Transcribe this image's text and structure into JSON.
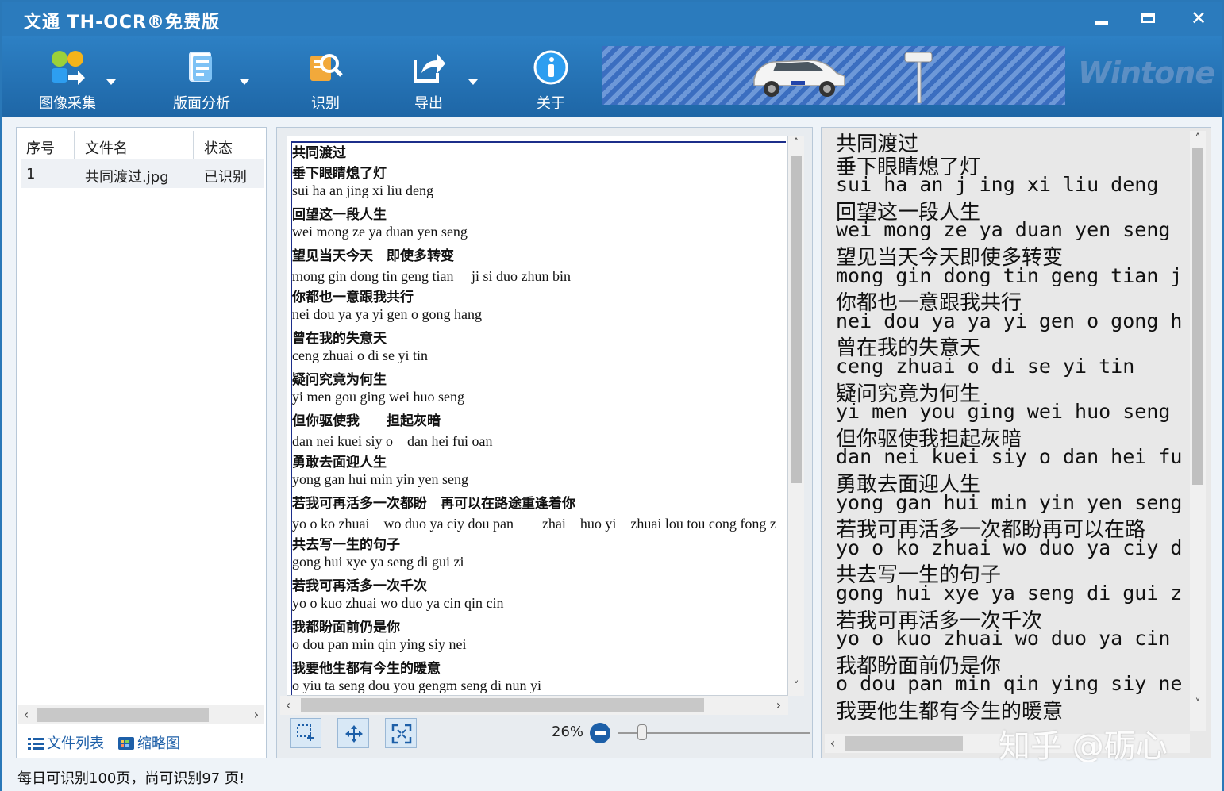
{
  "window": {
    "title": "文通 TH-OCR®免费版"
  },
  "toolbar": {
    "items": [
      {
        "label": "图像采集",
        "icon": "image-capture-icon"
      },
      {
        "label": "版面分析",
        "icon": "layout-analysis-icon"
      },
      {
        "label": "识别",
        "icon": "recognize-icon"
      },
      {
        "label": "导出",
        "icon": "export-icon"
      },
      {
        "label": "关于",
        "icon": "info-icon"
      }
    ],
    "brand": "Wintone"
  },
  "file_list": {
    "columns": [
      "序号",
      "文件名",
      "状态"
    ],
    "rows": [
      {
        "index": "1",
        "name": "共同渡过.jpg",
        "status": "已识别"
      }
    ],
    "tabs": [
      "文件列表",
      "缩略图"
    ]
  },
  "image_view": {
    "lines": [
      {
        "text": "共同渡过",
        "kind": "cn"
      },
      {
        "text": "垂下眼睛熄了灯",
        "kind": "cn"
      },
      {
        "text": "sui ha an jing xi liu deng",
        "kind": "py"
      },
      {
        "text": "回望这一段人生",
        "kind": "cn"
      },
      {
        "text": "wei mong ze ya duan yen seng",
        "kind": "py"
      },
      {
        "text": "望见当天今天　即使多转变",
        "kind": "cn"
      },
      {
        "text": "mong gin dong tin geng tian　 ji si duo zhun bin",
        "kind": "py"
      },
      {
        "text": "你都也一意跟我共行",
        "kind": "cn"
      },
      {
        "text": "nei dou ya ya yi gen o gong hang",
        "kind": "py"
      },
      {
        "text": "曾在我的失意天",
        "kind": "cn"
      },
      {
        "text": "ceng zhuai o di se yi tin",
        "kind": "py"
      },
      {
        "text": "疑问究竟为何生",
        "kind": "cn"
      },
      {
        "text": "yi men gou ging wei huo seng",
        "kind": "py"
      },
      {
        "text": "但你驱使我　　担起灰暗",
        "kind": "cn"
      },
      {
        "text": "dan nei kuei siy o　dan hei fui oan",
        "kind": "py"
      },
      {
        "text": "勇敢去面迎人生",
        "kind": "cn"
      },
      {
        "text": "yong gan hui min yin yen seng",
        "kind": "py"
      },
      {
        "text": "若我可再活多一次都盼　再可以在路途重逢着你",
        "kind": "cn"
      },
      {
        "text": "yo o ko zhuai　wo duo ya ciy dou pan　　zhai　huo yi　zhuai lou tou cong fong z",
        "kind": "py"
      },
      {
        "text": "共去写一生的句子",
        "kind": "cn"
      },
      {
        "text": "gong hui xye ya seng di gui zi",
        "kind": "py"
      },
      {
        "text": "若我可再活多一次千次",
        "kind": "cn"
      },
      {
        "text": "yo o kuo zhuai wo duo ya cin qin cin",
        "kind": "py"
      },
      {
        "text": "我都盼面前仍是你",
        "kind": "cn"
      },
      {
        "text": "o dou pan min qin ying siy nei",
        "kind": "py"
      },
      {
        "text": "我要他生都有今生的暖意",
        "kind": "cn"
      },
      {
        "text": "o yiu ta seng dou you gengm seng di nun yi",
        "kind": "py"
      }
    ],
    "zoom": "26%"
  },
  "result_text": {
    "lines": [
      {
        "text": "共同渡过",
        "kind": "cn"
      },
      {
        "text": "垂下眼睛熄了灯",
        "kind": "cn"
      },
      {
        "text": "sui ha an j ing xi liu deng",
        "kind": "py"
      },
      {
        "text": "回望这一段人生",
        "kind": "cn"
      },
      {
        "text": "wei mong ze ya duan yen seng",
        "kind": "py"
      },
      {
        "text": "望见当天今天即使多转变",
        "kind": "cn"
      },
      {
        "text": "mong gin dong tin geng tian j",
        "kind": "py"
      },
      {
        "text": "你都也一意跟我共行",
        "kind": "cn"
      },
      {
        "text": "nei dou ya ya yi gen o gong h",
        "kind": "py"
      },
      {
        "text": "曾在我的失意天",
        "kind": "cn"
      },
      {
        "text": "ceng zhuai o di se yi tin",
        "kind": "py"
      },
      {
        "text": "疑问究竟为何生",
        "kind": "cn"
      },
      {
        "text": "yi men you ging wei huo seng",
        "kind": "py"
      },
      {
        "text": "但你驱使我担起灰暗",
        "kind": "cn"
      },
      {
        "text": "dan nei kuei siy o dan hei fu",
        "kind": "py"
      },
      {
        "text": "勇敢去面迎人生",
        "kind": "cn"
      },
      {
        "text": "yong gan hui min yin yen seng",
        "kind": "py"
      },
      {
        "text": "若我可再活多一次都盼再可以在路",
        "kind": "cn"
      },
      {
        "text": "yo o ko zhuai wo duo ya ciy d",
        "kind": "py"
      },
      {
        "text": "共去写一生的句子",
        "kind": "cn"
      },
      {
        "text": "gong hui xye ya seng di gui z",
        "kind": "py"
      },
      {
        "text": "若我可再活多一次千次",
        "kind": "cn"
      },
      {
        "text": "yo o kuo zhuai wo duo ya cin",
        "kind": "py"
      },
      {
        "text": "我都盼面前仍是你",
        "kind": "cn"
      },
      {
        "text": "o dou pan min qin ying siy ne",
        "kind": "py"
      },
      {
        "text": "我要他生都有今生的暖意",
        "kind": "cn"
      }
    ]
  },
  "watermark": "知乎 @砺心",
  "status": {
    "text": "每日可识别100页，尚可识别97 页!"
  }
}
